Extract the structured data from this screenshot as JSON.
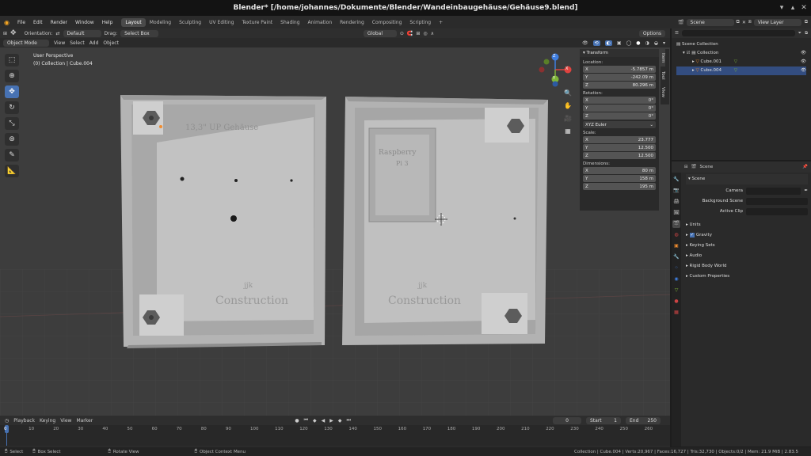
{
  "window": {
    "title": "Blender* [/home/johannes/Dokumente/Blender/Wandeinbaugehäuse/Gehäuse9.blend]"
  },
  "menu": {
    "items": [
      "File",
      "Edit",
      "Render",
      "Window",
      "Help"
    ],
    "workspaces": [
      "Layout",
      "Modeling",
      "Sculpting",
      "UV Editing",
      "Texture Paint",
      "Shading",
      "Animation",
      "Rendering",
      "Compositing",
      "Scripting"
    ],
    "plus": "+",
    "scene": "Scene",
    "view_layer": "View Layer"
  },
  "header": {
    "orientation_label": "Orientation:",
    "orientation": "Default",
    "drag_label": "Drag:",
    "drag": "Select Box",
    "transform_orientation": "Global",
    "options": "Options"
  },
  "header2": {
    "mode": "Object Mode",
    "menus": [
      "View",
      "Select",
      "Add",
      "Object"
    ]
  },
  "viewport": {
    "perspective": "User Perspective",
    "collection_info": "(0) Collection | Cube.004",
    "left_text": "13,3\" UP Gehäuse",
    "left_logo1": "jjk",
    "left_logo2": "Construction",
    "right_text1": "Raspberry",
    "right_text2": "Pi 3",
    "right_logo1": "jjk",
    "right_logo2": "Construction",
    "gizmo": {
      "z": "Z",
      "y": "Y",
      "x": "X"
    }
  },
  "npanel": {
    "title": "Transform",
    "tabs": [
      "Item",
      "Tool",
      "View"
    ],
    "location_label": "Location:",
    "location": [
      {
        "axis": "X",
        "value": "-5.7857 m"
      },
      {
        "axis": "Y",
        "value": "-242.09 m"
      },
      {
        "axis": "Z",
        "value": "80.296 m"
      }
    ],
    "rotation_label": "Rotation:",
    "rotation": [
      {
        "axis": "X",
        "value": "0°"
      },
      {
        "axis": "Y",
        "value": "0°"
      },
      {
        "axis": "Z",
        "value": "0°"
      }
    ],
    "rotation_mode": "XYZ Euler",
    "scale_label": "Scale:",
    "scale": [
      {
        "axis": "X",
        "value": "23.777"
      },
      {
        "axis": "Y",
        "value": "12.500"
      },
      {
        "axis": "Z",
        "value": "12.500"
      }
    ],
    "dimensions_label": "Dimensions:",
    "dimensions": [
      {
        "axis": "X",
        "value": "80 m"
      },
      {
        "axis": "Y",
        "value": "158 m"
      },
      {
        "axis": "Z",
        "value": "195 m"
      }
    ]
  },
  "outliner": {
    "root": "Scene Collection",
    "collection": "Collection",
    "items": [
      "Cube.001",
      "Cube.004"
    ]
  },
  "properties": {
    "scene_name": "Scene",
    "panel": "Scene",
    "camera_label": "Camera",
    "bg_scene_label": "Background Scene",
    "active_clip_label": "Active Clip",
    "sections": [
      "Units",
      "Gravity",
      "Keying Sets",
      "Audio",
      "Rigid Body World",
      "Custom Properties"
    ]
  },
  "timeline": {
    "menus": [
      "Playback",
      "Keying",
      "View",
      "Marker"
    ],
    "current": "0",
    "start_label": "Start",
    "start": "1",
    "end_label": "End",
    "end": "250",
    "ticks": [
      "0",
      "10",
      "20",
      "30",
      "40",
      "50",
      "60",
      "70",
      "80",
      "90",
      "100",
      "110",
      "120",
      "130",
      "140",
      "150",
      "160",
      "170",
      "180",
      "190",
      "200",
      "210",
      "220",
      "230",
      "240",
      "250",
      "260"
    ]
  },
  "status": {
    "select": "Select",
    "box_select": "Box Select",
    "rotate_view": "Rotate View",
    "context_menu": "Object Context Menu",
    "stats": "Collection | Cube.004 | Verts:20,967 | Faces:16,727 | Tris:32,730 | Objects:0/2 | Mem: 21.9 MiB | 2.83.5"
  },
  "colors": {
    "accent": "#4772b3",
    "bg": "#3d3d3d",
    "axis_x": "#e0433f",
    "axis_y": "#7fb537",
    "axis_z": "#3f7ee0",
    "selected": "#f08c2f"
  }
}
